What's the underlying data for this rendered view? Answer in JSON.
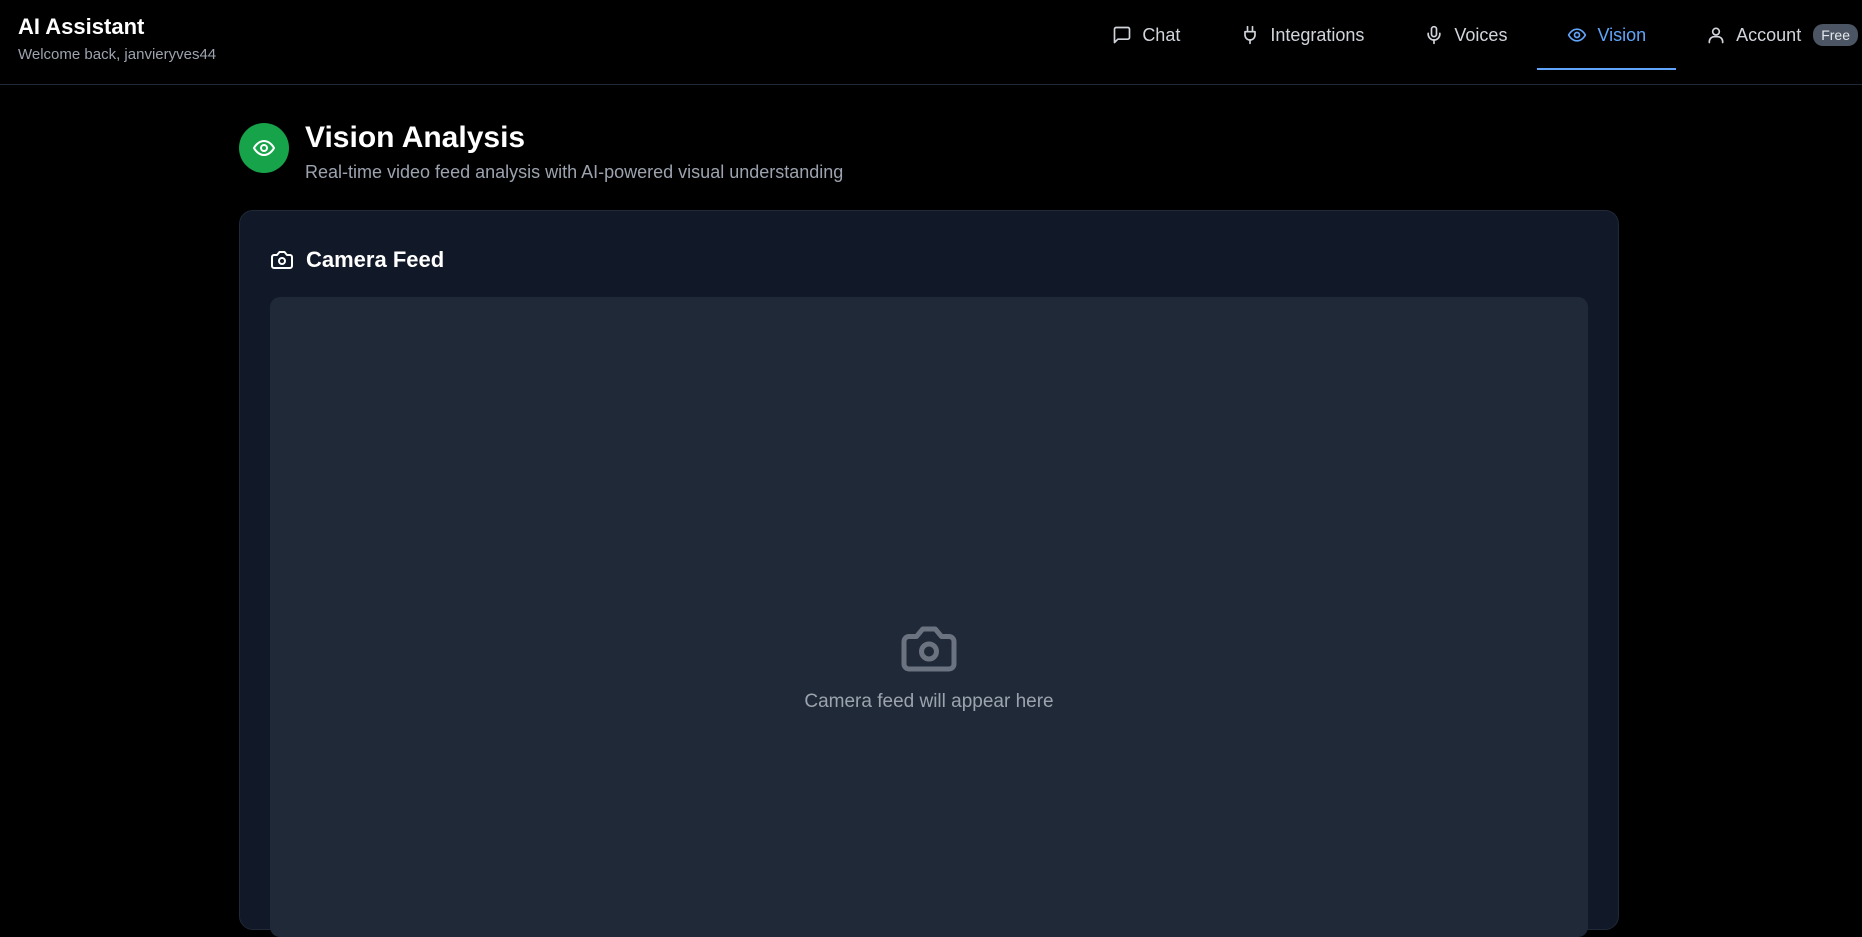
{
  "app": {
    "title": "AI Assistant",
    "welcome": "Welcome back, janvieryves44"
  },
  "nav": {
    "items": [
      {
        "label": "Chat",
        "icon": "chat-bubble-icon"
      },
      {
        "label": "Integrations",
        "icon": "plug-icon"
      },
      {
        "label": "Voices",
        "icon": "microphone-icon"
      },
      {
        "label": "Vision",
        "icon": "eye-icon",
        "active": true
      },
      {
        "label": "Account",
        "icon": "user-icon"
      }
    ],
    "account_badge": "Free",
    "active_color": "#60a5fa"
  },
  "page": {
    "title": "Vision Analysis",
    "subtitle": "Real-time video feed analysis with AI-powered visual understanding",
    "icon": "eye-icon",
    "icon_color": "#16a34a"
  },
  "camera": {
    "title": "Camera Feed",
    "placeholder": "Camera feed will appear here",
    "icon": "camera-icon"
  }
}
